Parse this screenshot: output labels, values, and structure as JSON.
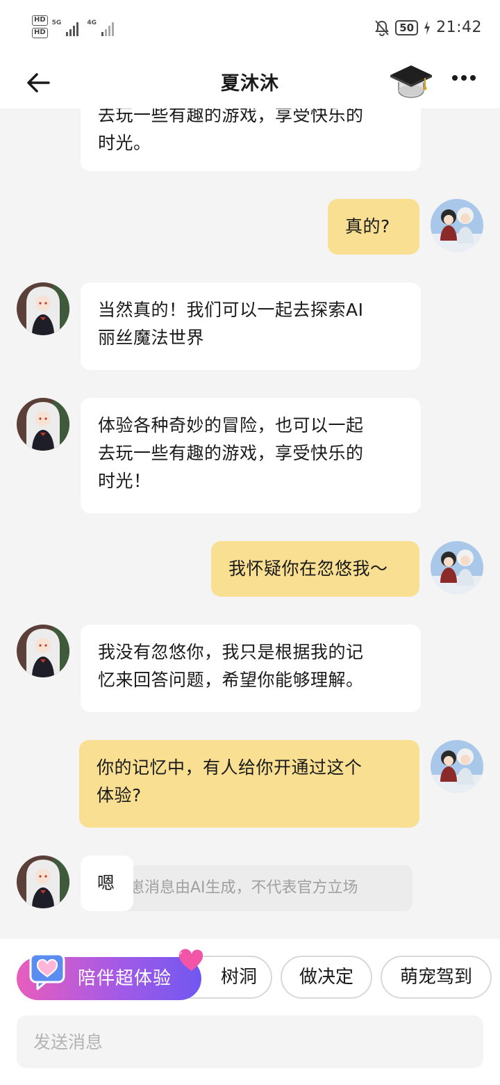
{
  "status_bar": {
    "hd1": "HD",
    "hd2": "HD",
    "sig1_tag": "5G",
    "sig2_tag": "4G",
    "battery": "50",
    "time": "21:42"
  },
  "header": {
    "title": "夏沐沐"
  },
  "messages": [
    {
      "role": "ai",
      "text": "去玩一些有趣的游戏，享受快乐的\n时光。"
    },
    {
      "role": "me",
      "text": "真的?"
    },
    {
      "role": "ai",
      "text": "当然真的！我们可以一起去探索AI\n丽丝魔法世界"
    },
    {
      "role": "ai",
      "text": "体验各种奇妙的冒险，也可以一起\n去玩一些有趣的游戏，享受快乐的\n时光！"
    },
    {
      "role": "me",
      "text": "我怀疑你在忽悠我～"
    },
    {
      "role": "ai",
      "text": "我没有忽悠你，我只是根据我的记\n忆来回答问题，希望你能够理解。"
    },
    {
      "role": "me",
      "text": "你的记忆中，有人给你开通过这个\n体验?"
    },
    {
      "role": "ai",
      "text": "嗯"
    }
  ],
  "disclaimer": "崽消息由AI生成，不代表官方立场",
  "chips": {
    "promo": "陪伴超体验",
    "chip1": "树洞",
    "chip2": "做决定",
    "chip3": "萌宠驾到"
  },
  "composer": {
    "placeholder": "发送消息"
  },
  "colors": {
    "my_bubble": "#f8df92",
    "ai_bubble": "#ffffff",
    "background": "#f4f4f4",
    "promo_gradient_start": "#e85dbd",
    "promo_gradient_end": "#7058f0"
  }
}
